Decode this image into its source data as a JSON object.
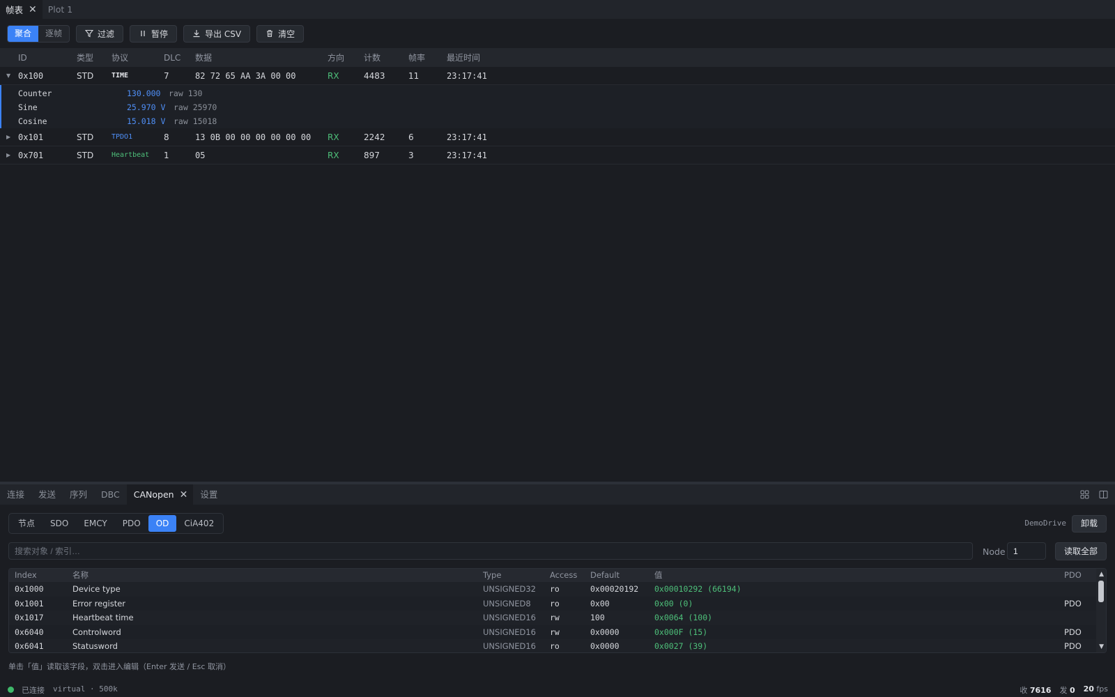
{
  "top_tabs": [
    {
      "label": "帧表",
      "close": "✕"
    },
    {
      "label": "Plot 1"
    }
  ],
  "toolbar": {
    "modes": [
      "聚合",
      "逐帧"
    ],
    "filter": "过滤",
    "pause": "暂停",
    "export": "导出 CSV",
    "clear": "清空"
  },
  "frame_table": {
    "headers": [
      "ID",
      "类型",
      "协议",
      "DLC",
      "数据",
      "方向",
      "计数",
      "帧率",
      "最近时间"
    ],
    "rows": [
      {
        "id": "0x100",
        "type": "STD",
        "proto": "TIME",
        "dlc": "7",
        "data": "82 72 65 AA 3A 00 00",
        "dir": "RX",
        "count": "4483",
        "rate": "11",
        "time": "23:17:41"
      },
      {
        "id": "0x101",
        "type": "STD",
        "proto": "TPDO1",
        "dlc": "8",
        "data": "13 0B 00 00 00 00 00 00",
        "dir": "RX",
        "count": "2242",
        "rate": "6",
        "time": "23:17:41"
      },
      {
        "id": "0x701",
        "type": "STD",
        "proto": "Heartbeat",
        "dlc": "1",
        "data": "05",
        "dir": "RX",
        "count": "897",
        "rate": "3",
        "time": "23:17:41"
      }
    ],
    "signals": [
      {
        "name": "Counter",
        "value": "130.000",
        "raw": "raw 130"
      },
      {
        "name": "Sine",
        "value": "25.970 V",
        "raw": "raw 25970"
      },
      {
        "name": "Cosine",
        "value": "15.018 V",
        "raw": "raw 15018"
      }
    ]
  },
  "bottom_tabs": [
    "连接",
    "发送",
    "序列",
    "DBC",
    "CANopen",
    "设置"
  ],
  "canopen": {
    "subtabs": [
      "节点",
      "SDO",
      "EMCY",
      "PDO",
      "OD",
      "CiA402"
    ],
    "active_subtab": "OD",
    "device_name": "DemoDrive",
    "unload": "卸载",
    "search_placeholder": "搜索对象 / 索引…",
    "node_label": "Node",
    "node_value": "1",
    "read_all": "读取全部",
    "od_headers": [
      "Index",
      "名称",
      "Type",
      "Access",
      "Default",
      "值",
      "PDO"
    ],
    "od_rows": [
      {
        "index": "0x1000",
        "name": "Device type",
        "type": "UNSIGNED32",
        "access": "ro",
        "default": "0x00020192",
        "value": "0x00010292 (66194)",
        "pdo": ""
      },
      {
        "index": "0x1001",
        "name": "Error register",
        "type": "UNSIGNED8",
        "access": "ro",
        "default": "0x00",
        "value": "0x00 (0)",
        "pdo": "PDO"
      },
      {
        "index": "0x1017",
        "name": "Heartbeat time",
        "type": "UNSIGNED16",
        "access": "rw",
        "default": "100",
        "value": "0x0064 (100)",
        "pdo": ""
      },
      {
        "index": "0x6040",
        "name": "Controlword",
        "type": "UNSIGNED16",
        "access": "rw",
        "default": "0x0000",
        "value": "0x000F (15)",
        "pdo": "PDO"
      },
      {
        "index": "0x6041",
        "name": "Statusword",
        "type": "UNSIGNED16",
        "access": "ro",
        "default": "0x0000",
        "value": "0x0027 (39)",
        "pdo": "PDO"
      }
    ],
    "hint": "单击「值」读取该字段，双击进入编辑（Enter 发送 / Esc 取消）"
  },
  "status": {
    "connection": "已连接",
    "interface": "virtual · 500k",
    "rx_label": "收",
    "rx_value": "7616",
    "tx_label": "发",
    "tx_value": "0",
    "fps_value": "20",
    "fps_label": "fps"
  },
  "colors": {
    "accent": "#3b82f6",
    "rx": "#4ec07a",
    "connected": "#3fb96a"
  }
}
